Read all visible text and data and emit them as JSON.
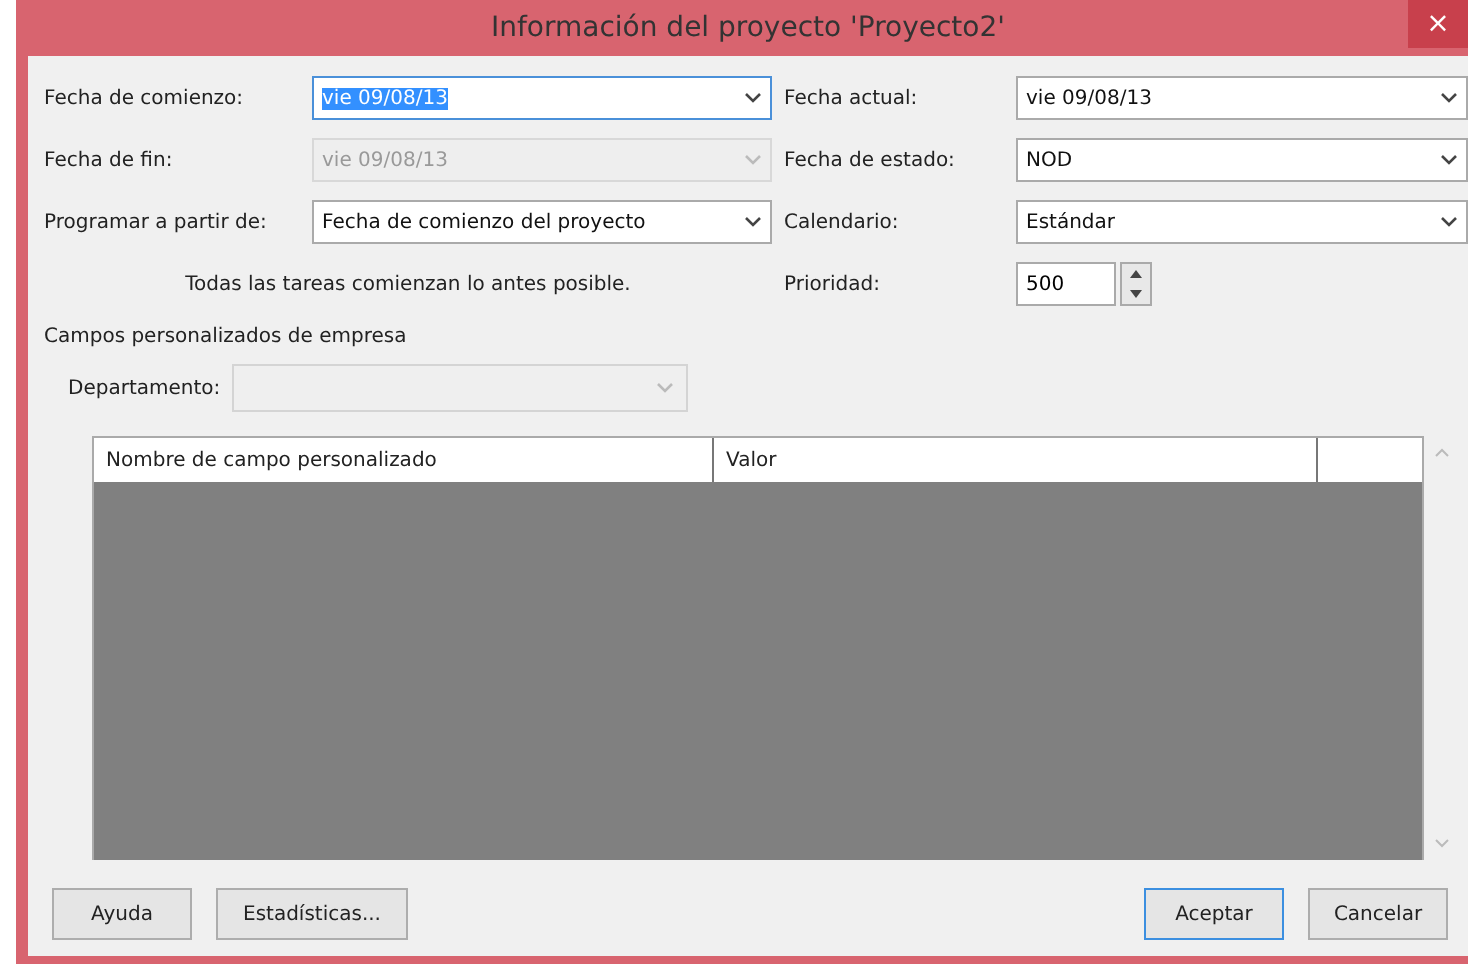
{
  "window": {
    "title": "Información del proyecto 'Proyecto2'",
    "close": "×"
  },
  "left_fields": [
    {
      "label": "Fecha de comienzo:",
      "value": "vie 09/08/13",
      "disabled": false,
      "focused": true
    },
    {
      "label": "Fecha de fin:",
      "value": "vie 09/08/13",
      "disabled": true,
      "focused": false
    },
    {
      "label": "Programar a partir de:",
      "value": "Fecha de comienzo del proyecto",
      "disabled": false,
      "focused": false
    }
  ],
  "note": "Todas las tareas comienzan lo antes posible.",
  "right_fields": [
    {
      "label": "Fecha actual:",
      "value": "vie 09/08/13",
      "kind": "dropdown"
    },
    {
      "label": "Fecha de estado:",
      "value": "NOD",
      "kind": "dropdown"
    },
    {
      "label": "Calendario:",
      "value": "Estándar",
      "kind": "dropdown"
    },
    {
      "label": "Prioridad:",
      "value": "500",
      "kind": "spinner"
    }
  ],
  "enterprise": {
    "title": "Campos personalizados de empresa",
    "department": {
      "label": "Departamento:",
      "disabled": true
    },
    "table": {
      "columns": [
        "Nombre de campo personalizado",
        "Valor"
      ]
    }
  },
  "buttons": [
    {
      "label": "Ayuda",
      "default": false
    },
    {
      "label": "Estadísticas...",
      "default": false
    },
    {
      "label": "Aceptar",
      "default": true
    },
    {
      "label": "Cancelar",
      "default": false
    }
  ]
}
